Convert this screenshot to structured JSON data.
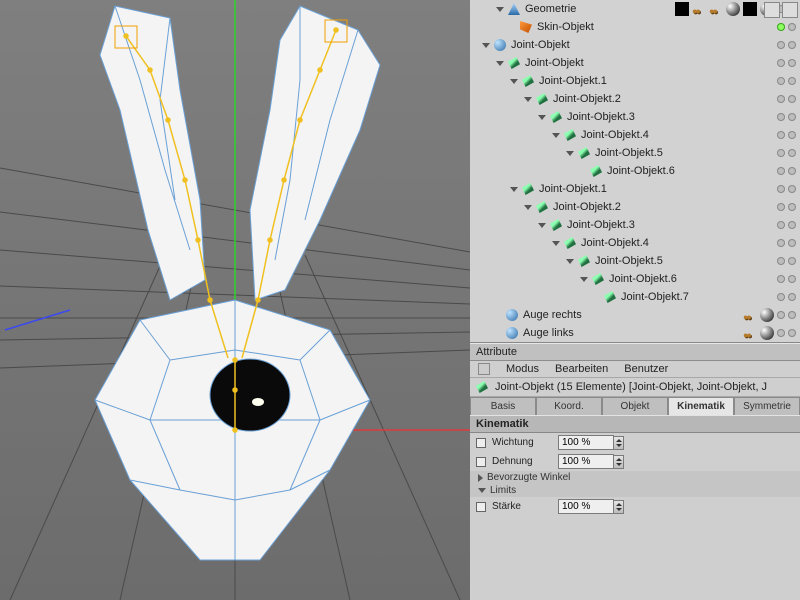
{
  "tree": {
    "items": [
      {
        "indent": 1,
        "twisty": "open",
        "icon": "geo",
        "label": "Geometrie",
        "dots": [
          "off",
          "off"
        ],
        "chips": [
          "check",
          "balls",
          "balls",
          "sphere",
          "check",
          "sphere"
        ]
      },
      {
        "indent": 2,
        "twisty": "none",
        "icon": "skin",
        "label": "Skin-Objekt",
        "dots": [
          "on",
          "off"
        ]
      },
      {
        "indent": 0,
        "twisty": "open",
        "icon": "null",
        "label": "Joint-Objekt",
        "dots": [
          "off",
          "off"
        ]
      },
      {
        "indent": 1,
        "twisty": "open",
        "icon": "joint",
        "label": "Joint-Objekt",
        "dots": [
          "off",
          "off"
        ]
      },
      {
        "indent": 2,
        "twisty": "open",
        "icon": "joint",
        "label": "Joint-Objekt.1",
        "dots": [
          "off",
          "off"
        ]
      },
      {
        "indent": 3,
        "twisty": "open",
        "icon": "joint",
        "label": "Joint-Objekt.2",
        "dots": [
          "off",
          "off"
        ]
      },
      {
        "indent": 4,
        "twisty": "open",
        "icon": "joint",
        "label": "Joint-Objekt.3",
        "dots": [
          "off",
          "off"
        ]
      },
      {
        "indent": 5,
        "twisty": "open",
        "icon": "joint",
        "label": "Joint-Objekt.4",
        "dots": [
          "off",
          "off"
        ]
      },
      {
        "indent": 6,
        "twisty": "open",
        "icon": "joint",
        "label": "Joint-Objekt.5",
        "dots": [
          "off",
          "off"
        ]
      },
      {
        "indent": 7,
        "twisty": "none",
        "icon": "joint",
        "label": "Joint-Objekt.6",
        "dots": [
          "off",
          "off"
        ]
      },
      {
        "indent": 2,
        "twisty": "open",
        "icon": "joint",
        "label": "Joint-Objekt.1",
        "dots": [
          "off",
          "off"
        ]
      },
      {
        "indent": 3,
        "twisty": "open",
        "icon": "joint",
        "label": "Joint-Objekt.2",
        "dots": [
          "off",
          "off"
        ]
      },
      {
        "indent": 4,
        "twisty": "open",
        "icon": "joint",
        "label": "Joint-Objekt.3",
        "dots": [
          "off",
          "off"
        ]
      },
      {
        "indent": 5,
        "twisty": "open",
        "icon": "joint",
        "label": "Joint-Objekt.4",
        "dots": [
          "off",
          "off"
        ]
      },
      {
        "indent": 6,
        "twisty": "open",
        "icon": "joint",
        "label": "Joint-Objekt.5",
        "dots": [
          "off",
          "off"
        ]
      },
      {
        "indent": 7,
        "twisty": "open",
        "icon": "joint",
        "label": "Joint-Objekt.6",
        "dots": [
          "off",
          "off"
        ]
      },
      {
        "indent": 8,
        "twisty": "none",
        "icon": "joint",
        "label": "Joint-Objekt.7",
        "dots": [
          "off",
          "off"
        ]
      },
      {
        "indent": 1,
        "twisty": "none",
        "icon": "null",
        "label": "Auge rechts",
        "dots": [
          "off",
          "off"
        ],
        "chips": [
          "balls",
          "sphere"
        ]
      },
      {
        "indent": 1,
        "twisty": "none",
        "icon": "null",
        "label": "Auge links",
        "dots": [
          "off",
          "off"
        ],
        "chips": [
          "balls",
          "sphere"
        ]
      }
    ]
  },
  "attributes": {
    "header": "Attribute",
    "menus": {
      "modus": "Modus",
      "bearbeiten": "Bearbeiten",
      "benutzer": "Benutzer"
    },
    "selection_icon": "joint",
    "selection_text": "Joint-Objekt (15 Elemente) [Joint-Objekt, Joint-Objekt, J",
    "tabs": [
      {
        "label": "Basis",
        "active": false
      },
      {
        "label": "Koord.",
        "active": false
      },
      {
        "label": "Objekt",
        "active": false
      },
      {
        "label": "Kinematik",
        "active": true
      },
      {
        "label": "Symmetrie",
        "active": false
      }
    ],
    "section": "Kinematik",
    "props": {
      "wichtung": {
        "label": "Wichtung",
        "value": "100 %"
      },
      "dehnung": {
        "label": "Dehnung",
        "value": "100 %"
      },
      "winkel": "Bevorzugte Winkel",
      "limits": "Limits",
      "staerke": {
        "label": "Stärke",
        "value": "100 %"
      }
    }
  }
}
